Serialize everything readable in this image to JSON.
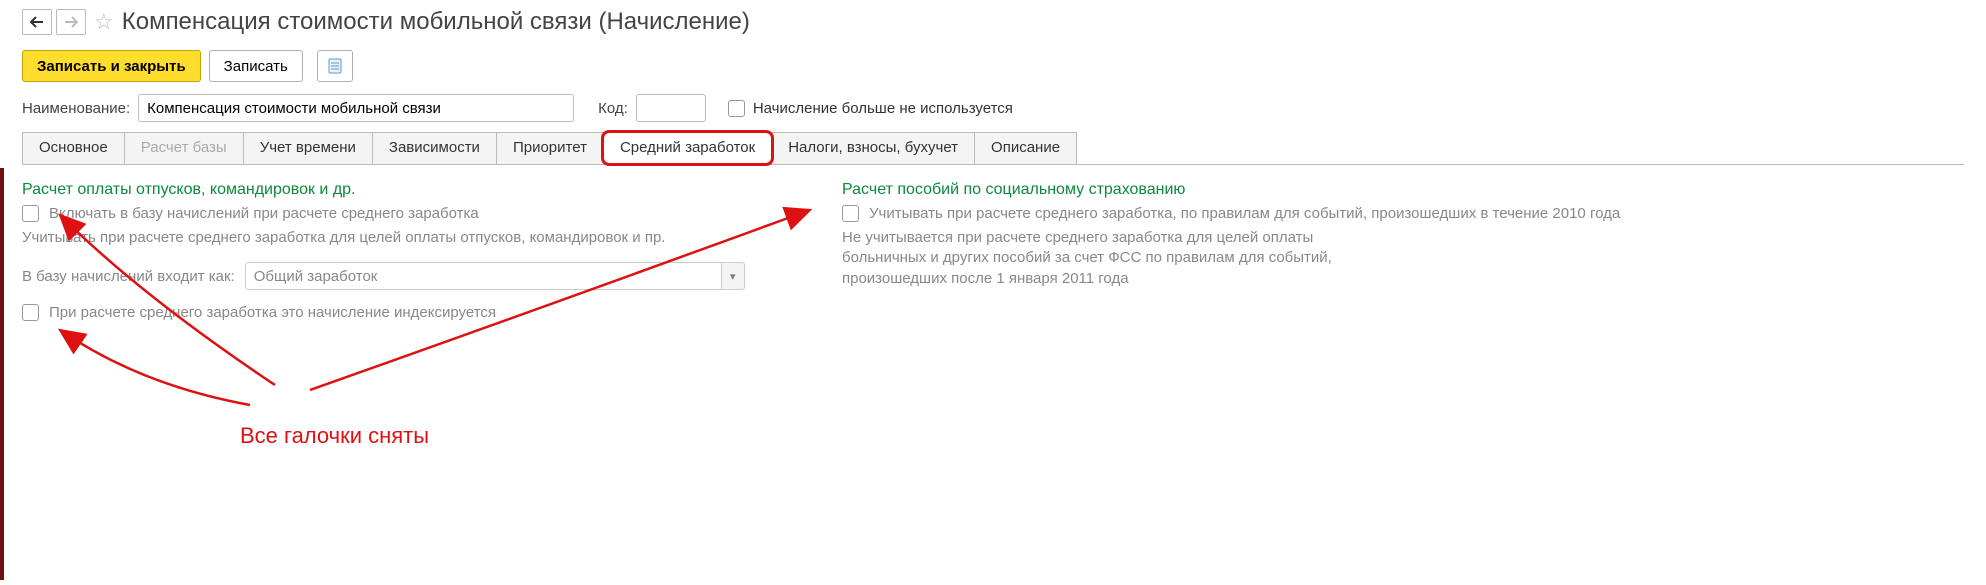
{
  "header": {
    "title": "Компенсация стоимости мобильной связи (Начисление)"
  },
  "toolbar": {
    "save_close": "Записать и закрыть",
    "save": "Записать"
  },
  "form": {
    "name_label": "Наименование:",
    "name_value": "Компенсация стоимости мобильной связи",
    "code_label": "Код:",
    "code_value": "",
    "deprecated_label": "Начисление больше не используется"
  },
  "tabs": [
    {
      "label": "Основное"
    },
    {
      "label": "Расчет базы"
    },
    {
      "label": "Учет времени"
    },
    {
      "label": "Зависимости"
    },
    {
      "label": "Приоритет"
    },
    {
      "label": "Средний заработок"
    },
    {
      "label": "Налоги, взносы, бухучет"
    },
    {
      "label": "Описание"
    }
  ],
  "left": {
    "section_title": "Расчет оплаты отпусков, командировок и др.",
    "check1_label": "Включать в базу начислений при расчете среднего заработка",
    "check1_hint": "Учитывать при расчете среднего заработка для целей оплаты отпусков, командировок и пр.",
    "base_label": "В базу начислений входит как:",
    "base_value": "Общий заработок",
    "check2_label": "При расчете среднего заработка это начисление индексируется"
  },
  "right": {
    "section_title": "Расчет пособий по социальному страхованию",
    "check1_label": "Учитывать при расчете среднего заработка, по правилам для событий, произошедших в течение 2010 года",
    "check1_hint": "Не учитывается при расчете среднего заработка для целей оплаты больничных и других пособий за счет ФСС по правилам для событий, произошедших после 1 января 2011 года"
  },
  "annotation": {
    "text": "Все галочки сняты"
  }
}
